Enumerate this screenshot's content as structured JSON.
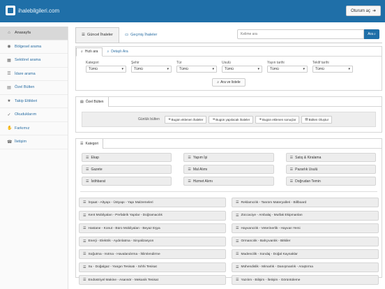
{
  "header": {
    "logo_text": "ihalebilgileri.com",
    "login_label": "Oturum aç",
    "login_icon": "sign-in-icon"
  },
  "sidebar": {
    "items": [
      {
        "label": "Anasayfa",
        "icon": "home-icon",
        "glyph": "⌂",
        "active": true
      },
      {
        "label": "Bölgesel arama",
        "icon": "map-marker-icon",
        "glyph": "◉"
      },
      {
        "label": "Sektörel arama",
        "icon": "grid-icon",
        "glyph": "▦"
      },
      {
        "label": "İdare arama",
        "icon": "list-icon",
        "glyph": "☰"
      },
      {
        "label": "Özel Bülten",
        "icon": "calendar-icon",
        "glyph": "▤"
      },
      {
        "label": "Takip Ettikleri",
        "icon": "star-icon",
        "glyph": "★"
      },
      {
        "label": "Okuduklarım",
        "icon": "check-icon",
        "glyph": "✓"
      },
      {
        "label": "Farkımız",
        "icon": "thumbs-up-icon",
        "glyph": "✋"
      },
      {
        "label": "İletişim",
        "icon": "phone-icon",
        "glyph": "☎"
      }
    ]
  },
  "main_tabs": [
    {
      "label": "Güncel İhaleler",
      "icon": "list-icon",
      "glyph": "☰",
      "active": true
    },
    {
      "label": "Geçmiş İhaleler",
      "icon": "archive-icon",
      "glyph": "🗀"
    }
  ],
  "search": {
    "placeholder": "Kelime ara",
    "button_label": "Ara"
  },
  "search_panel": {
    "tabs": [
      {
        "label": "Hızlı ara",
        "icon": "search-icon",
        "glyph": "⌕",
        "active": true
      },
      {
        "label": "Detaylı Ara",
        "icon": "search-plus-icon",
        "glyph": "⌕"
      }
    ],
    "filters": [
      {
        "label": "Kategori",
        "value": "Tümü"
      },
      {
        "label": "Şehir",
        "value": "Tümü"
      },
      {
        "label": "Tür",
        "value": "Tümü"
      },
      {
        "label": "Usulü",
        "value": "Tümü"
      },
      {
        "label": "Yayın tarihi",
        "value": "Tümü"
      },
      {
        "label": "Teklif tarihi",
        "value": "Tümü"
      }
    ],
    "apply_label": "Ara ve listele"
  },
  "bulten": {
    "tab_label": "Özel Bülten",
    "row_label": "Günlük bülten",
    "buttons": [
      "Bugün eklenen ihaleler",
      "Bugün yapılacak ihaleler",
      "Bugün eklenen sonuçlar",
      "Bülten Oluştur"
    ]
  },
  "categories": {
    "tab_label": "Kategori",
    "top": [
      "Ekap",
      "Yapım İşi",
      "Satış & Kiralama",
      "Gazete",
      "Mal Alımı",
      "Pazarlık Usulü",
      "İstihbarat",
      "Hizmet Alımı",
      "Doğrudan Temin"
    ],
    "sectors": [
      "İnşaat - Altyapı - Üstyapı - Yapı Malzemeleri",
      "Reklamcılık - Tanıtım Materyalleri - Billboard",
      "Kent Mobilyaları - Prefabrik Yapılar - Doğramacılık",
      "Züccaciye - Ambalaj - Mutfak Ekipmanları",
      "Hastane - Konut - Büro Mobilyaları - Beyaz Eşya",
      "Hayvancılık - Veterinerlik - Hayvan Yemi",
      "Enerji - Elektrik - Aydınlatma - Sinyalizasyon",
      "Ormancılık - Bahçıvanlık - Bitkiler",
      "Soğutma - Isıtma - Havalandırma - İklimlendirme",
      "Madencilik - Sondaj - Doğal Kaynaklar",
      "Su - Doğalgaz - Yangın Tesisatı - Sıhhi Tesisat",
      "Mühendislik - Mimarlık - Danışmanlık - Araştırma",
      "Endüstriyel Makine - Asansör - Mekanik Tesisat",
      "Yazılım - Bilişim - İletişim - Görüntüleme"
    ]
  }
}
